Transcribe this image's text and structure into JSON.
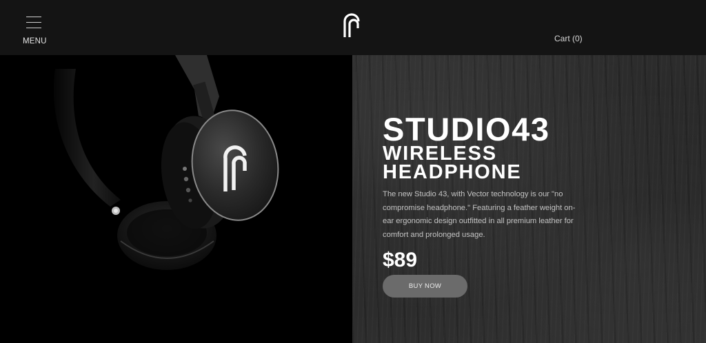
{
  "header": {
    "menu_label": "MENU",
    "cart_label": "Cart (0)"
  },
  "hero": {
    "product_name": "STUDIO43",
    "subtitle_line1": "WIRELESS",
    "subtitle_line2": "HEADPHONE",
    "description": "The new Studio 43, with Vector technology is our \"no compromise headphone.\" Featuring a feather weight on-ear ergonomic design outfitted in all premium leather for comfort and prolonged usage.",
    "price": "$89",
    "cta_label": "BUY NOW"
  },
  "colors": {
    "header_bg": "#141414",
    "button_bg": "#6b6b6b",
    "text_primary": "#ffffff"
  }
}
